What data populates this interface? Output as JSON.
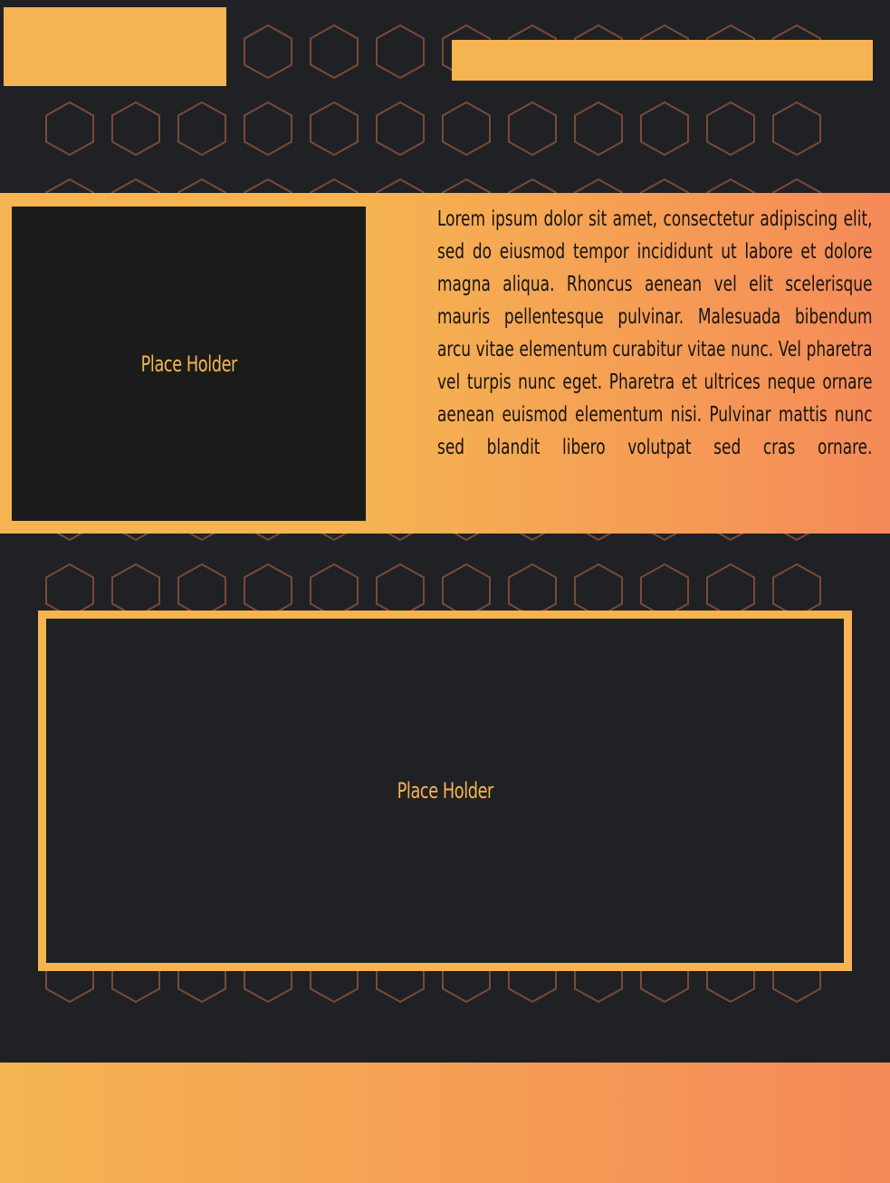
{
  "colors": {
    "background": "#202124",
    "accent": "#f5b451",
    "accent_end": "#f58a58",
    "hexagon_stroke": "#7a4a36",
    "placeholder_fill": "#1b1b1b",
    "body_text": "#141414"
  },
  "feature": {
    "image_placeholder_label": "Place Holder",
    "paragraph": "Lorem ipsum dolor sit amet, consectetur adipiscing elit, sed do eiusmod tempor incididunt ut labore et dolore magna aliqua. Rhoncus aenean vel elit scelerisque mauris pellentesque pulvinar. Malesuada bibendum arcu vitae elementum curabitur vitae nunc. Vel pharetra vel turpis nunc eget. Pharetra et ultrices neque ornare aenean euismod elementum nisi. Pulvinar mattis nunc sed blandit libero volutpat sed cras ornare."
  },
  "gallery": {
    "image_placeholder_label": "Place Holder"
  },
  "background_pattern": {
    "icon": "hexagon-outline-icon"
  }
}
